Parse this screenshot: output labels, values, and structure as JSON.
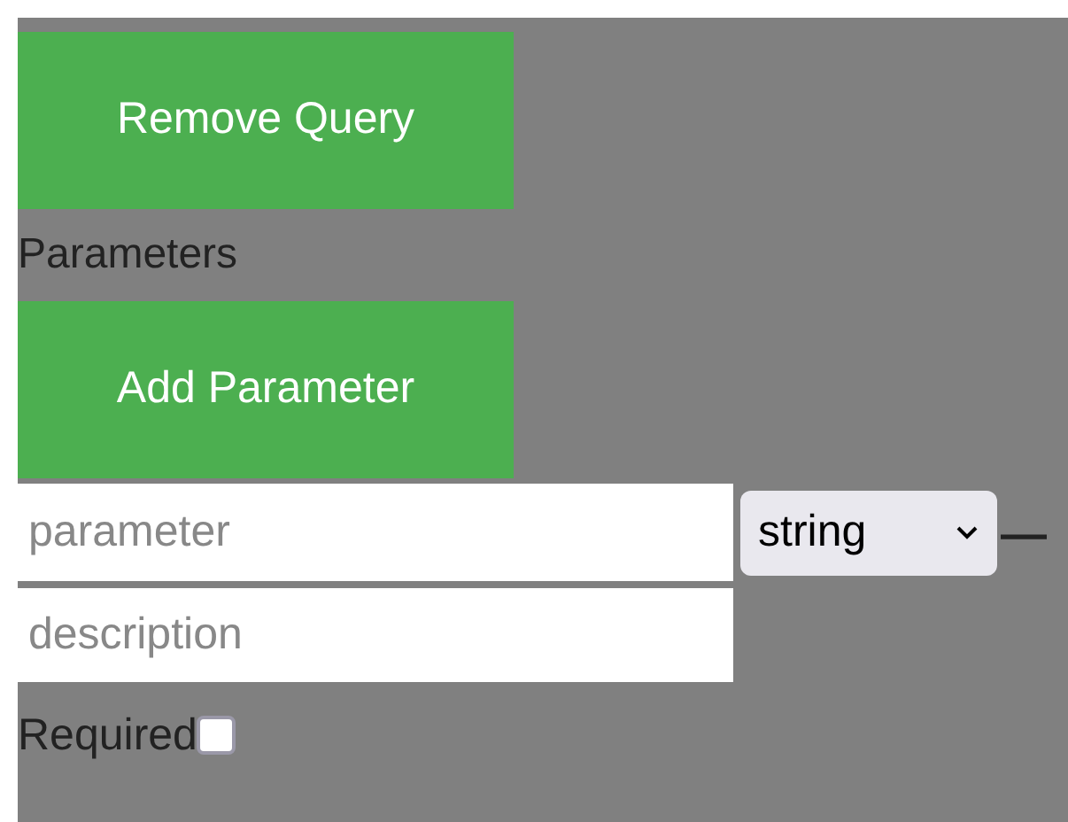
{
  "remove_query_button": "Remove Query",
  "parameters_heading": "Parameters",
  "add_parameter_button": "Add Parameter",
  "parameters": [
    {
      "name_placeholder": "parameter",
      "type": "string",
      "remove_button": "—",
      "description_placeholder": "description",
      "required_label": "Required",
      "required": false
    }
  ]
}
